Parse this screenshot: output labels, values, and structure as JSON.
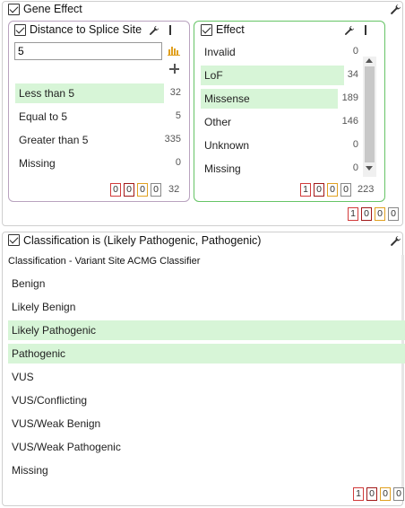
{
  "gene_panel": {
    "title": "Gene Effect",
    "distance_card": {
      "title": "Distance to Splice Site",
      "input_value": "5",
      "items": [
        {
          "label": "Less than 5",
          "count": "32",
          "selected": true
        },
        {
          "label": "Equal to 5",
          "count": "5",
          "selected": false
        },
        {
          "label": "Greater than 5",
          "count": "335",
          "selected": false
        },
        {
          "label": "Missing",
          "count": "0",
          "selected": false
        }
      ],
      "footer_boxes": [
        "0",
        "0",
        "0",
        "0"
      ],
      "footer_total": "32"
    },
    "effect_card": {
      "title": "Effect",
      "items": [
        {
          "label": "Invalid",
          "count": "0",
          "selected": false
        },
        {
          "label": "LoF",
          "count": "34",
          "selected": true
        },
        {
          "label": "Missense",
          "count": "189",
          "selected": true
        },
        {
          "label": "Other",
          "count": "146",
          "selected": false
        },
        {
          "label": "Unknown",
          "count": "0",
          "selected": false
        },
        {
          "label": "Missing",
          "count": "0",
          "selected": false
        }
      ],
      "footer_boxes": [
        "1",
        "0",
        "0",
        "0"
      ],
      "footer_total": "223"
    },
    "footer_boxes": [
      "1",
      "0",
      "0",
      "0"
    ]
  },
  "classification_panel": {
    "title": "Classification is (Likely Pathogenic, Pathogenic)",
    "subtitle": "Classification - Variant Site ACMG Classifier",
    "items": [
      {
        "label": "Benign",
        "selected": false
      },
      {
        "label": "Likely Benign",
        "selected": false
      },
      {
        "label": "Likely Pathogenic",
        "selected": true
      },
      {
        "label": "Pathogenic",
        "selected": true
      },
      {
        "label": "VUS",
        "selected": false
      },
      {
        "label": "VUS/Conflicting",
        "selected": false
      },
      {
        "label": "VUS/Weak Benign",
        "selected": false
      },
      {
        "label": "VUS/Weak Pathogenic",
        "selected": false
      },
      {
        "label": "Missing",
        "selected": false
      }
    ],
    "footer_boxes": [
      "1",
      "0",
      "0",
      "0"
    ]
  },
  "colors": {
    "selected_row": "#d7f5d7",
    "distance_border": "#b9a3bf",
    "effect_border": "#66c466",
    "box_red": "#d23a3a",
    "box_darkred": "#a11818",
    "box_orange": "#e0a020",
    "box_gray": "#888888"
  }
}
